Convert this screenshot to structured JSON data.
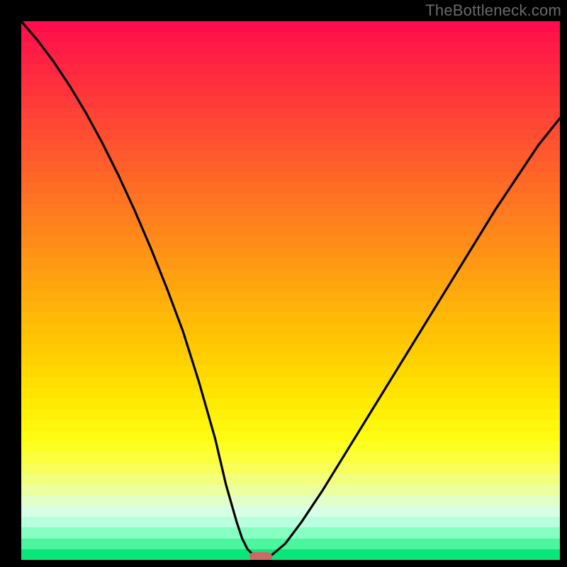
{
  "watermark": "TheBottleneck.com",
  "chart_data": {
    "type": "line",
    "title": "",
    "xlabel": "",
    "ylabel": "",
    "xlim": [
      0,
      100
    ],
    "ylim": [
      0,
      100
    ],
    "x": [
      0,
      3,
      6,
      9,
      12,
      15,
      18,
      21,
      24,
      27,
      30,
      33,
      36,
      38,
      40,
      41,
      42,
      43,
      44.5,
      46,
      49,
      52,
      56,
      60,
      64,
      68,
      72,
      76,
      80,
      84,
      88,
      92,
      96,
      100
    ],
    "values": [
      100,
      96.5,
      92.5,
      88,
      83,
      77.5,
      71.5,
      65,
      58,
      50.5,
      42.5,
      33,
      22.5,
      14,
      7,
      4,
      2,
      1,
      0.5,
      0.5,
      3,
      7,
      13,
      19.5,
      26,
      32.5,
      39,
      45.5,
      52,
      58.5,
      65,
      71,
      77,
      82
    ],
    "marker": {
      "x": 44.5,
      "y": 0.5
    },
    "legend": false,
    "grid": false,
    "background_gradient": {
      "stops": [
        {
          "pos": 0.0,
          "color": "#ff0b4c"
        },
        {
          "pos": 0.1,
          "color": "#ff2b3f"
        },
        {
          "pos": 0.2,
          "color": "#ff4a33"
        },
        {
          "pos": 0.3,
          "color": "#ff6a26"
        },
        {
          "pos": 0.4,
          "color": "#ff891a"
        },
        {
          "pos": 0.5,
          "color": "#ffa90d"
        },
        {
          "pos": 0.6,
          "color": "#ffc801"
        },
        {
          "pos": 0.7,
          "color": "#ffe700"
        },
        {
          "pos": 0.78,
          "color": "#ffff14"
        },
        {
          "pos": 0.83,
          "color": "#f8ff58"
        },
        {
          "pos": 0.87,
          "color": "#ecffa1"
        },
        {
          "pos": 0.905,
          "color": "#ddffe5"
        },
        {
          "pos": 0.925,
          "color": "#c3ffe7"
        },
        {
          "pos": 0.94,
          "color": "#a1ffd1"
        },
        {
          "pos": 0.955,
          "color": "#7affba"
        },
        {
          "pos": 0.968,
          "color": "#52f7a3"
        },
        {
          "pos": 0.98,
          "color": "#2bee8d"
        },
        {
          "pos": 0.992,
          "color": "#05e477"
        },
        {
          "pos": 1.0,
          "color": "#00e074"
        }
      ]
    }
  }
}
